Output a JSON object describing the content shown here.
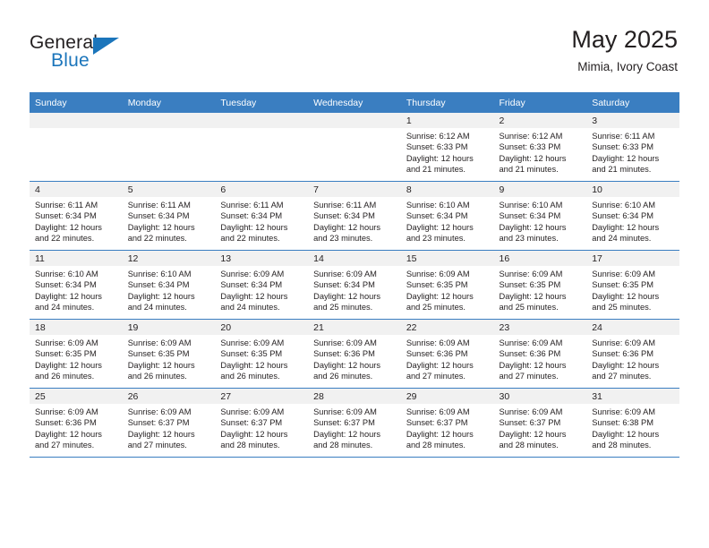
{
  "brand": {
    "name_top": "General",
    "name_bottom": "Blue",
    "accent_color": "#1b75bb",
    "triangle_icon": "brand-triangle-icon"
  },
  "header": {
    "title": "May 2025",
    "subtitle": "Mimia, Ivory Coast"
  },
  "calendar": {
    "header_bg": "#3a7ec1",
    "daynum_bg": "#f1f1f1",
    "weekday_headers": [
      "Sunday",
      "Monday",
      "Tuesday",
      "Wednesday",
      "Thursday",
      "Friday",
      "Saturday"
    ],
    "weeks": [
      [
        {
          "day": "",
          "sunrise": "",
          "sunset": "",
          "daylight_1": "",
          "daylight_2": ""
        },
        {
          "day": "",
          "sunrise": "",
          "sunset": "",
          "daylight_1": "",
          "daylight_2": ""
        },
        {
          "day": "",
          "sunrise": "",
          "sunset": "",
          "daylight_1": "",
          "daylight_2": ""
        },
        {
          "day": "",
          "sunrise": "",
          "sunset": "",
          "daylight_1": "",
          "daylight_2": ""
        },
        {
          "day": "1",
          "sunrise": "Sunrise: 6:12 AM",
          "sunset": "Sunset: 6:33 PM",
          "daylight_1": "Daylight: 12 hours",
          "daylight_2": "and 21 minutes."
        },
        {
          "day": "2",
          "sunrise": "Sunrise: 6:12 AM",
          "sunset": "Sunset: 6:33 PM",
          "daylight_1": "Daylight: 12 hours",
          "daylight_2": "and 21 minutes."
        },
        {
          "day": "3",
          "sunrise": "Sunrise: 6:11 AM",
          "sunset": "Sunset: 6:33 PM",
          "daylight_1": "Daylight: 12 hours",
          "daylight_2": "and 21 minutes."
        }
      ],
      [
        {
          "day": "4",
          "sunrise": "Sunrise: 6:11 AM",
          "sunset": "Sunset: 6:34 PM",
          "daylight_1": "Daylight: 12 hours",
          "daylight_2": "and 22 minutes."
        },
        {
          "day": "5",
          "sunrise": "Sunrise: 6:11 AM",
          "sunset": "Sunset: 6:34 PM",
          "daylight_1": "Daylight: 12 hours",
          "daylight_2": "and 22 minutes."
        },
        {
          "day": "6",
          "sunrise": "Sunrise: 6:11 AM",
          "sunset": "Sunset: 6:34 PM",
          "daylight_1": "Daylight: 12 hours",
          "daylight_2": "and 22 minutes."
        },
        {
          "day": "7",
          "sunrise": "Sunrise: 6:11 AM",
          "sunset": "Sunset: 6:34 PM",
          "daylight_1": "Daylight: 12 hours",
          "daylight_2": "and 23 minutes."
        },
        {
          "day": "8",
          "sunrise": "Sunrise: 6:10 AM",
          "sunset": "Sunset: 6:34 PM",
          "daylight_1": "Daylight: 12 hours",
          "daylight_2": "and 23 minutes."
        },
        {
          "day": "9",
          "sunrise": "Sunrise: 6:10 AM",
          "sunset": "Sunset: 6:34 PM",
          "daylight_1": "Daylight: 12 hours",
          "daylight_2": "and 23 minutes."
        },
        {
          "day": "10",
          "sunrise": "Sunrise: 6:10 AM",
          "sunset": "Sunset: 6:34 PM",
          "daylight_1": "Daylight: 12 hours",
          "daylight_2": "and 24 minutes."
        }
      ],
      [
        {
          "day": "11",
          "sunrise": "Sunrise: 6:10 AM",
          "sunset": "Sunset: 6:34 PM",
          "daylight_1": "Daylight: 12 hours",
          "daylight_2": "and 24 minutes."
        },
        {
          "day": "12",
          "sunrise": "Sunrise: 6:10 AM",
          "sunset": "Sunset: 6:34 PM",
          "daylight_1": "Daylight: 12 hours",
          "daylight_2": "and 24 minutes."
        },
        {
          "day": "13",
          "sunrise": "Sunrise: 6:09 AM",
          "sunset": "Sunset: 6:34 PM",
          "daylight_1": "Daylight: 12 hours",
          "daylight_2": "and 24 minutes."
        },
        {
          "day": "14",
          "sunrise": "Sunrise: 6:09 AM",
          "sunset": "Sunset: 6:34 PM",
          "daylight_1": "Daylight: 12 hours",
          "daylight_2": "and 25 minutes."
        },
        {
          "day": "15",
          "sunrise": "Sunrise: 6:09 AM",
          "sunset": "Sunset: 6:35 PM",
          "daylight_1": "Daylight: 12 hours",
          "daylight_2": "and 25 minutes."
        },
        {
          "day": "16",
          "sunrise": "Sunrise: 6:09 AM",
          "sunset": "Sunset: 6:35 PM",
          "daylight_1": "Daylight: 12 hours",
          "daylight_2": "and 25 minutes."
        },
        {
          "day": "17",
          "sunrise": "Sunrise: 6:09 AM",
          "sunset": "Sunset: 6:35 PM",
          "daylight_1": "Daylight: 12 hours",
          "daylight_2": "and 25 minutes."
        }
      ],
      [
        {
          "day": "18",
          "sunrise": "Sunrise: 6:09 AM",
          "sunset": "Sunset: 6:35 PM",
          "daylight_1": "Daylight: 12 hours",
          "daylight_2": "and 26 minutes."
        },
        {
          "day": "19",
          "sunrise": "Sunrise: 6:09 AM",
          "sunset": "Sunset: 6:35 PM",
          "daylight_1": "Daylight: 12 hours",
          "daylight_2": "and 26 minutes."
        },
        {
          "day": "20",
          "sunrise": "Sunrise: 6:09 AM",
          "sunset": "Sunset: 6:35 PM",
          "daylight_1": "Daylight: 12 hours",
          "daylight_2": "and 26 minutes."
        },
        {
          "day": "21",
          "sunrise": "Sunrise: 6:09 AM",
          "sunset": "Sunset: 6:36 PM",
          "daylight_1": "Daylight: 12 hours",
          "daylight_2": "and 26 minutes."
        },
        {
          "day": "22",
          "sunrise": "Sunrise: 6:09 AM",
          "sunset": "Sunset: 6:36 PM",
          "daylight_1": "Daylight: 12 hours",
          "daylight_2": "and 27 minutes."
        },
        {
          "day": "23",
          "sunrise": "Sunrise: 6:09 AM",
          "sunset": "Sunset: 6:36 PM",
          "daylight_1": "Daylight: 12 hours",
          "daylight_2": "and 27 minutes."
        },
        {
          "day": "24",
          "sunrise": "Sunrise: 6:09 AM",
          "sunset": "Sunset: 6:36 PM",
          "daylight_1": "Daylight: 12 hours",
          "daylight_2": "and 27 minutes."
        }
      ],
      [
        {
          "day": "25",
          "sunrise": "Sunrise: 6:09 AM",
          "sunset": "Sunset: 6:36 PM",
          "daylight_1": "Daylight: 12 hours",
          "daylight_2": "and 27 minutes."
        },
        {
          "day": "26",
          "sunrise": "Sunrise: 6:09 AM",
          "sunset": "Sunset: 6:37 PM",
          "daylight_1": "Daylight: 12 hours",
          "daylight_2": "and 27 minutes."
        },
        {
          "day": "27",
          "sunrise": "Sunrise: 6:09 AM",
          "sunset": "Sunset: 6:37 PM",
          "daylight_1": "Daylight: 12 hours",
          "daylight_2": "and 28 minutes."
        },
        {
          "day": "28",
          "sunrise": "Sunrise: 6:09 AM",
          "sunset": "Sunset: 6:37 PM",
          "daylight_1": "Daylight: 12 hours",
          "daylight_2": "and 28 minutes."
        },
        {
          "day": "29",
          "sunrise": "Sunrise: 6:09 AM",
          "sunset": "Sunset: 6:37 PM",
          "daylight_1": "Daylight: 12 hours",
          "daylight_2": "and 28 minutes."
        },
        {
          "day": "30",
          "sunrise": "Sunrise: 6:09 AM",
          "sunset": "Sunset: 6:37 PM",
          "daylight_1": "Daylight: 12 hours",
          "daylight_2": "and 28 minutes."
        },
        {
          "day": "31",
          "sunrise": "Sunrise: 6:09 AM",
          "sunset": "Sunset: 6:38 PM",
          "daylight_1": "Daylight: 12 hours",
          "daylight_2": "and 28 minutes."
        }
      ]
    ]
  }
}
